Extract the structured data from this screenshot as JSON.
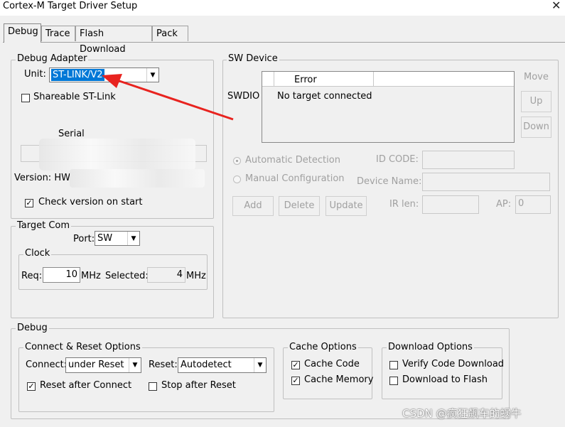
{
  "window": {
    "title": "Cortex-M Target Driver Setup"
  },
  "tabs": [
    {
      "label": "Debug"
    },
    {
      "label": "Trace"
    },
    {
      "label": "Flash Download"
    },
    {
      "label": "Pack"
    }
  ],
  "debug_adapter": {
    "legend": "Debug Adapter",
    "unit_label": "Unit:",
    "unit_value": "ST-LINK/V2",
    "shareable_label": "Shareable ST-Link",
    "serial_label": "Serial",
    "version_label": "Version: HW",
    "check_version_label": "Check version on start"
  },
  "target_com": {
    "legend": "Target Com",
    "port_label": "Port:",
    "port_value": "SW",
    "clock_legend": "Clock",
    "req_label": "Req:",
    "req_value": "10",
    "req_unit": "MHz",
    "selected_label": "Selected:",
    "selected_value": "4",
    "selected_unit": "MHz"
  },
  "sw_device": {
    "legend": "SW Device",
    "swdio_label": "SWDIO",
    "col_error": "Error",
    "row_text": "No target connected",
    "move_label": "Move",
    "up_label": "Up",
    "down_label": "Down",
    "auto_detection": "Automatic Detection",
    "manual_config": "Manual Configuration",
    "id_code_label": "ID CODE:",
    "device_name_label": "Device Name:",
    "add_label": "Add",
    "delete_label": "Delete",
    "update_label": "Update",
    "ir_len_label": "IR len:",
    "ap_label": "AP:",
    "ap_value": "0"
  },
  "debug_section": {
    "legend": "Debug",
    "connect_reset": {
      "legend": "Connect & Reset Options",
      "connect_label": "Connect:",
      "connect_value": "under Reset",
      "reset_label": "Reset:",
      "reset_value": "Autodetect",
      "reset_after_connect": "Reset after Connect",
      "stop_after_reset": "Stop after Reset"
    },
    "cache": {
      "legend": "Cache Options",
      "cache_code": "Cache Code",
      "cache_memory": "Cache Memory"
    },
    "download": {
      "legend": "Download Options",
      "verify": "Verify Code Download",
      "download_flash": "Download to Flash"
    }
  },
  "watermark": "CSDN @疯狂飙车的蜗牛",
  "annotation": {
    "arrow_color": "#e8231f"
  }
}
